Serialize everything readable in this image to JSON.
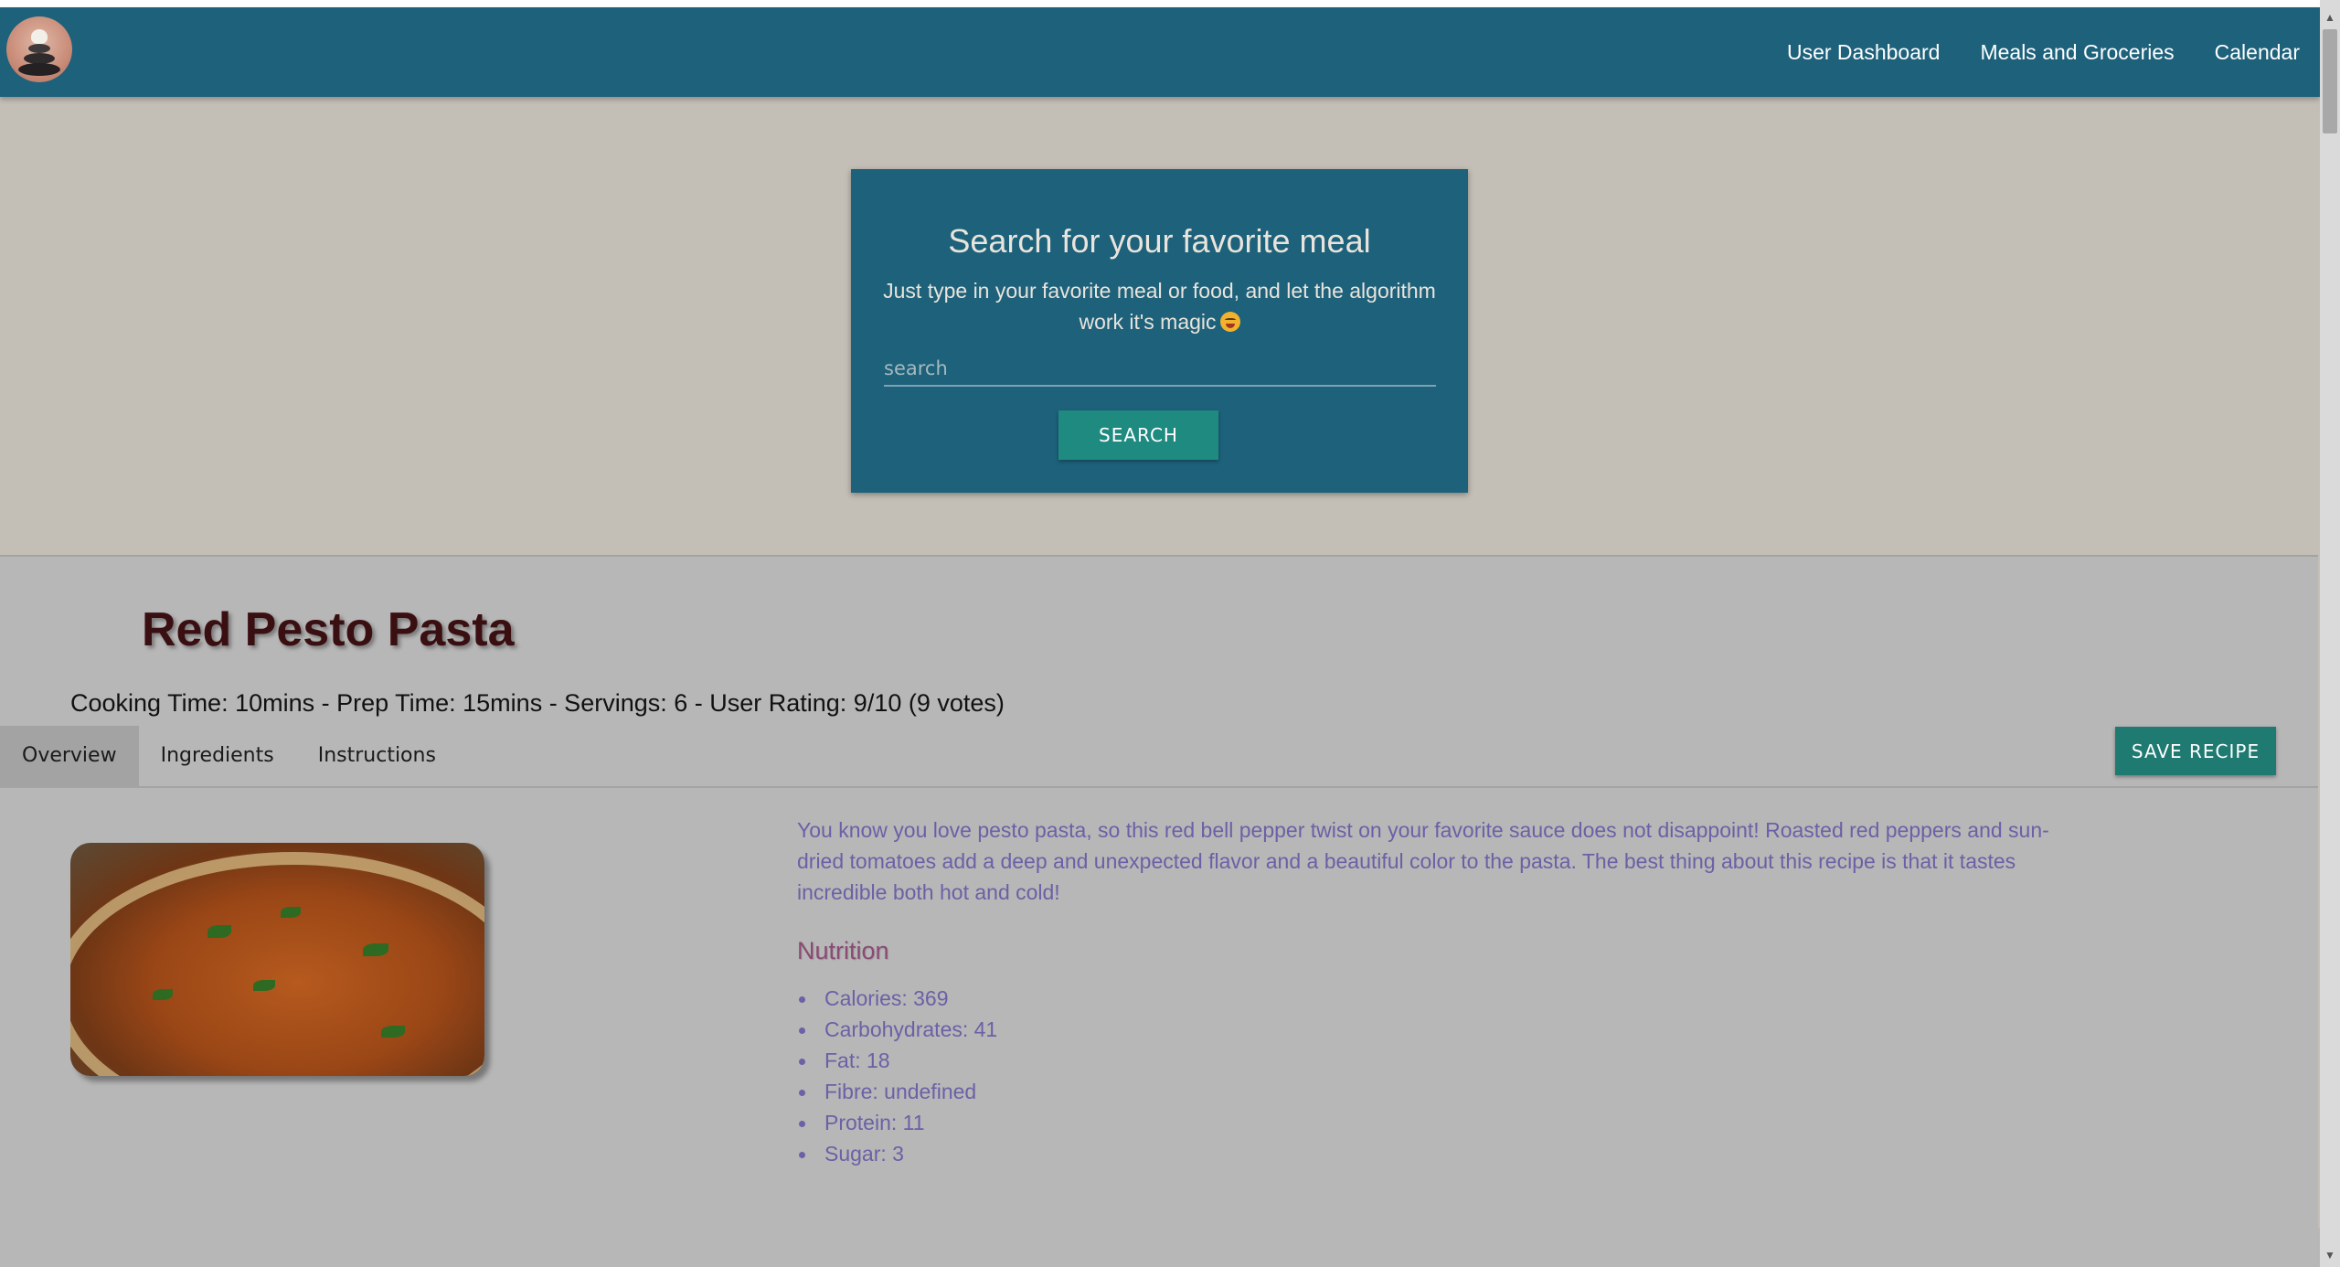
{
  "nav": {
    "logo_alt": "logo",
    "links": [
      "User Dashboard",
      "Meals and Groceries",
      "Calendar"
    ]
  },
  "search": {
    "title": "Search for your favorite meal",
    "subtitle": "Just type in your favorite meal or food, and let the algorithm work it's magic",
    "placeholder": "search",
    "button_label": "SEARCH"
  },
  "recipe": {
    "title": "Red Pesto Pasta",
    "meta": "Cooking Time: 10mins - Prep Time: 15mins - Servings: 6 - User Rating: 9/10 (9 votes)",
    "tabs": [
      "Overview",
      "Ingredients",
      "Instructions"
    ],
    "active_tab": "Overview",
    "save_label": "SAVE RECIPE",
    "description": "You know you love pesto pasta, so this red bell pepper twist on your favorite sauce does not disappoint! Roasted red peppers and sun-dried tomatoes add a deep and unexpected flavor and a beautiful color to the pasta. The best thing about this recipe is that it tastes incredible both hot and cold!",
    "nutrition_heading": "Nutrition",
    "nutrition": [
      "Calories: 369",
      "Carbohydrates: 41",
      "Fat: 18",
      "Fibre: undefined",
      "Protein: 11",
      "Sugar: 3"
    ]
  },
  "colors": {
    "navbar": "#1d617b",
    "page_bg": "#c3beb6",
    "accent_button": "#1f8a80",
    "recipe_panel": "#b7b7b7",
    "body_text": "#6a61a6",
    "nutrition_heading": "#8a4a73"
  }
}
